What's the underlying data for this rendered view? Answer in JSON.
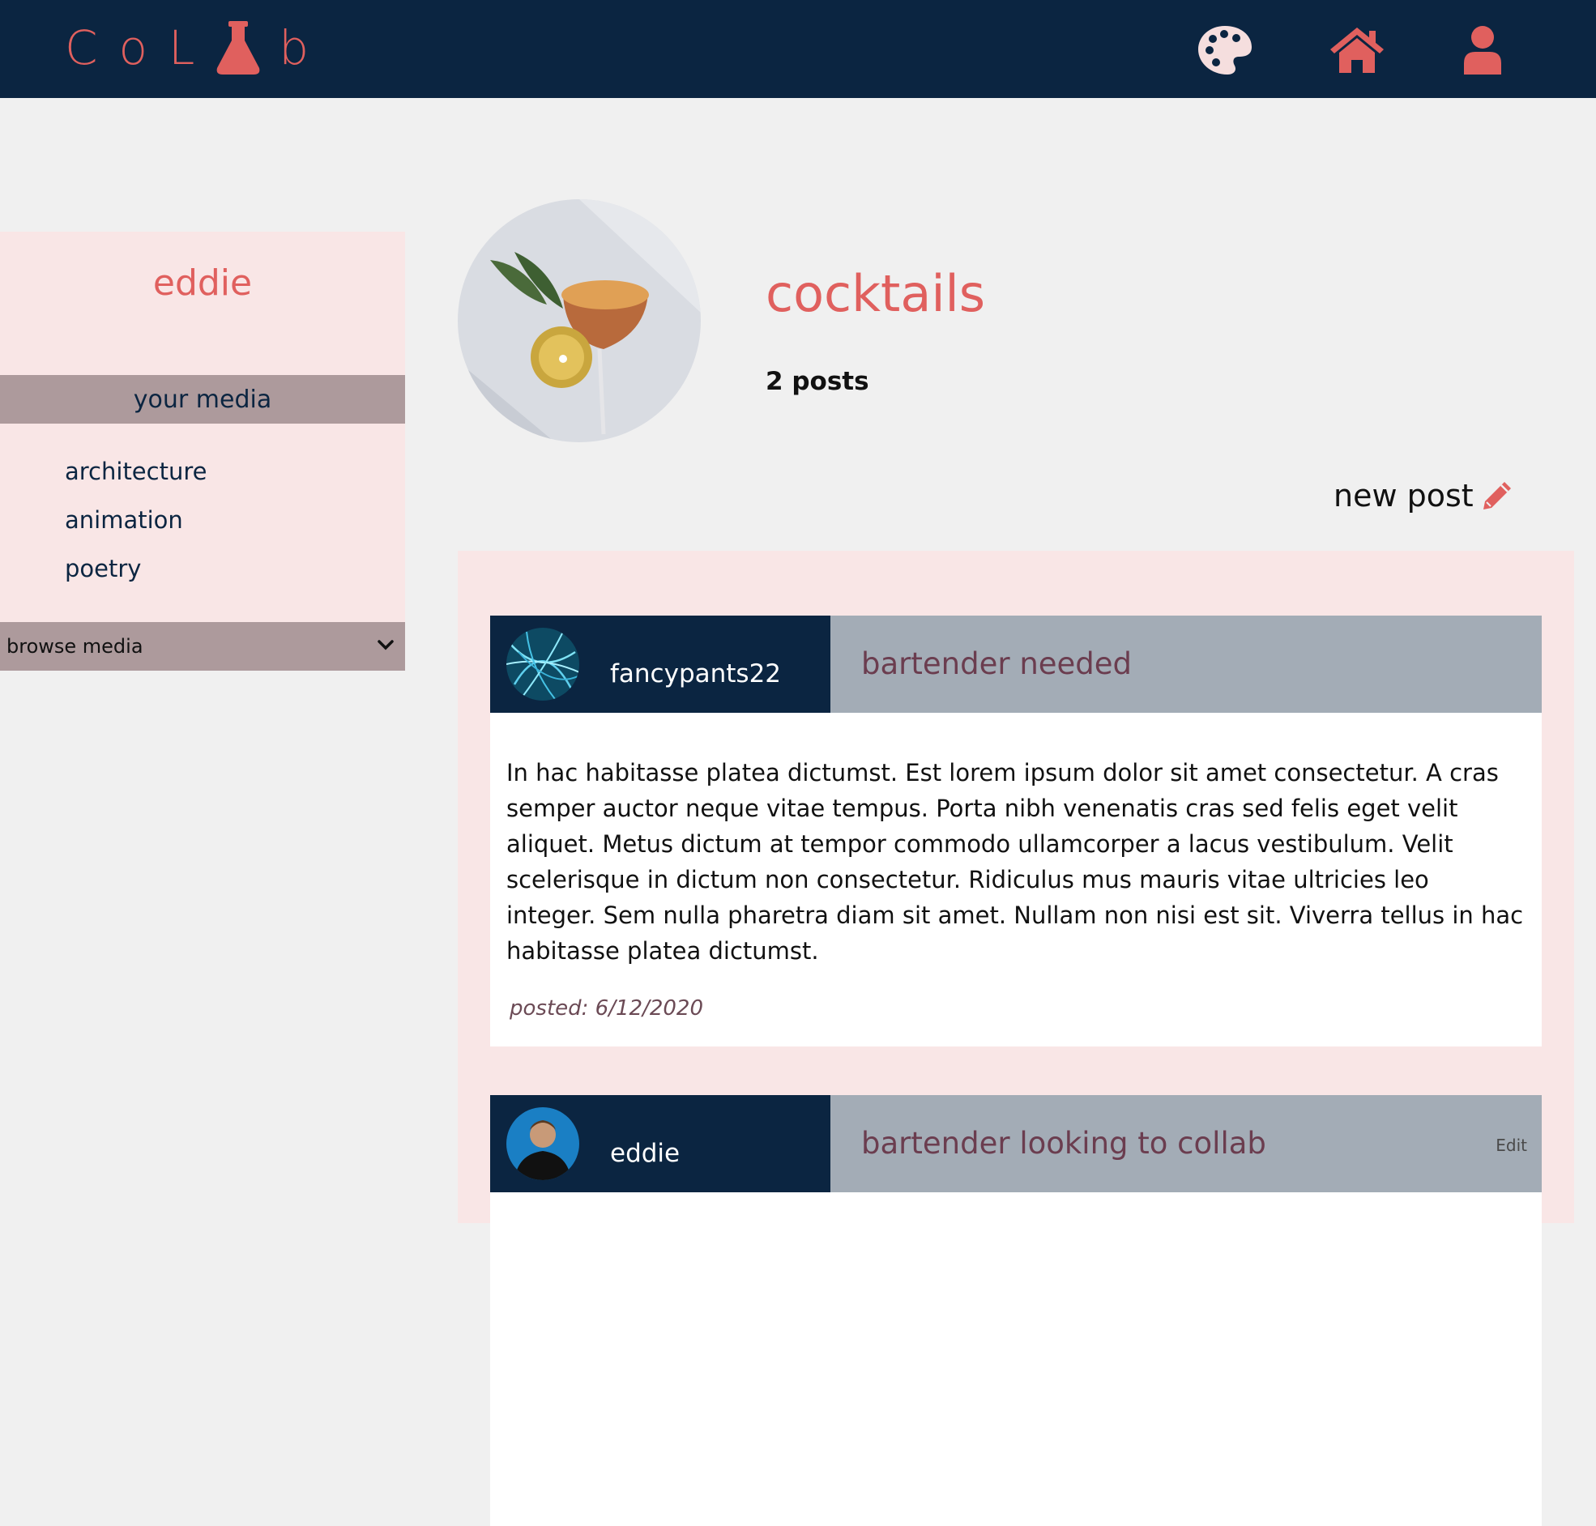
{
  "app": {
    "logo_text": "CoLab"
  },
  "nav": {
    "icons": [
      "palette-icon",
      "home-icon",
      "user-icon"
    ]
  },
  "sidebar": {
    "username": "eddie",
    "section_title": "your media",
    "links": [
      "architecture",
      "animation",
      "poetry"
    ],
    "browse_label": "browse media"
  },
  "board": {
    "title": "cocktails",
    "post_count": "2 posts",
    "new_post_label": "new post"
  },
  "posts": [
    {
      "author": "fancypants22",
      "title": "bartender needed",
      "body": "In hac habitasse platea dictumst. Est lorem ipsum dolor sit amet consectetur. A cras semper auctor neque vitae tempus. Porta nibh venenatis cras sed felis eget velit aliquet. Metus dictum at tempor commodo ullamcorper a lacus vestibulum. Velit scelerisque in dictum non consectetur. Ridiculus mus mauris vitae ultricies leo integer. Sem nulla pharetra diam sit amet. Nullam non nisi est sit. Viverra tellus in hac habitasse platea dictumst.",
      "date": "posted: 6/12/2020"
    },
    {
      "author": "eddie",
      "title": "bartender looking to collab",
      "edit_label": "Edit"
    }
  ],
  "colors": {
    "navy": "#0b2541",
    "coral": "#e0605e",
    "pink_panel": "#f9e6e6",
    "mauve": "#ad9a9c",
    "slate": "#a3acb6"
  }
}
